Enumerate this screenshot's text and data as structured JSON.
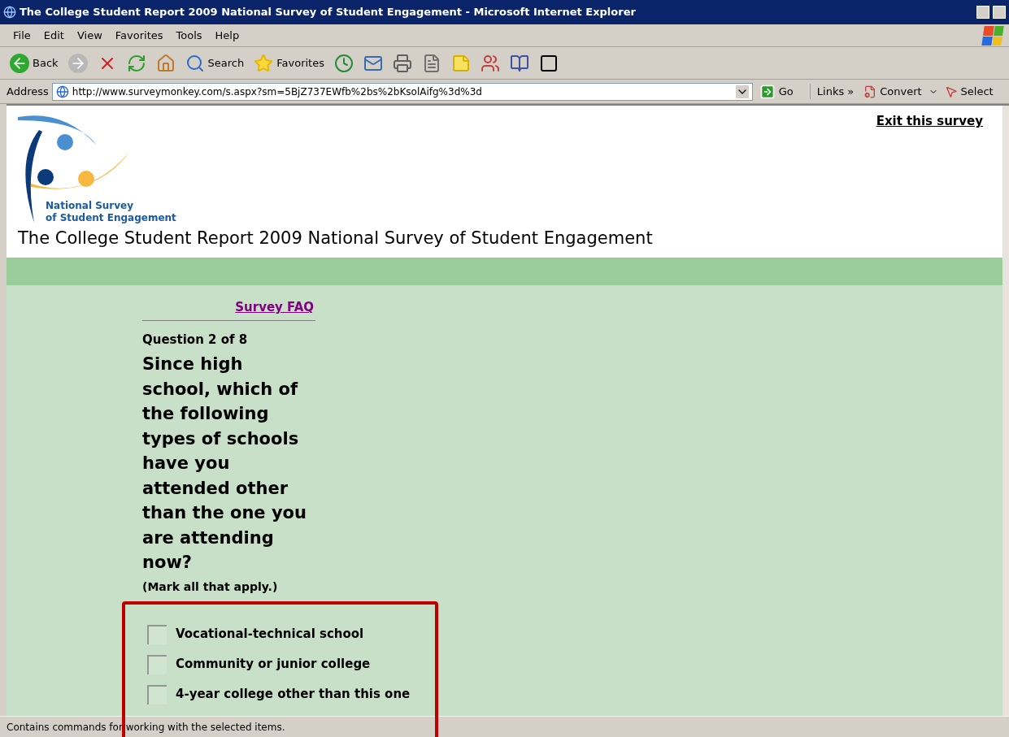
{
  "window": {
    "title": "The College Student Report 2009 National Survey of Student Engagement - Microsoft Internet Explorer"
  },
  "menu": [
    "File",
    "Edit",
    "View",
    "Favorites",
    "Tools",
    "Help"
  ],
  "toolbar": [
    {
      "kind": "back",
      "label": "Back"
    },
    {
      "kind": "forward"
    },
    {
      "kind": "stop"
    },
    {
      "kind": "refresh"
    },
    {
      "kind": "home"
    },
    {
      "kind": "search",
      "label": "Search"
    },
    {
      "kind": "favorites",
      "label": "Favorites"
    },
    {
      "kind": "history"
    },
    {
      "kind": "mail"
    },
    {
      "kind": "print"
    },
    {
      "kind": "edit"
    },
    {
      "kind": "note"
    },
    {
      "kind": "messenger"
    },
    {
      "kind": "research"
    },
    {
      "kind": "frame"
    }
  ],
  "address": {
    "label": "Address",
    "url": "http://www.surveymonkey.com/s.aspx?sm=5BjZ737EWfb%2bs%2bKsolAifg%3d%3d",
    "go": "Go",
    "links": "Links",
    "chevron": "»",
    "convert": "Convert",
    "select": "Select"
  },
  "page": {
    "exit_link": "Exit this survey",
    "logo": [
      "National Survey",
      "of Student Engagement"
    ],
    "survey_title": "The College Student Report 2009 National Survey of Student Engagement",
    "faq_link": "Survey FAQ",
    "question_number": "Question 2 of 8",
    "question": "Since high school, which of the following types of schools have you attended other than the one you are attending now?",
    "instruction": "(Mark all that apply.)",
    "options": [
      {
        "label": "Vocational-technical school",
        "checked": false
      },
      {
        "label": "Community or junior college",
        "checked": false
      },
      {
        "label": "4-year college other than this one",
        "checked": false
      }
    ]
  },
  "status_bar": "Contains commands for working with the selected items."
}
